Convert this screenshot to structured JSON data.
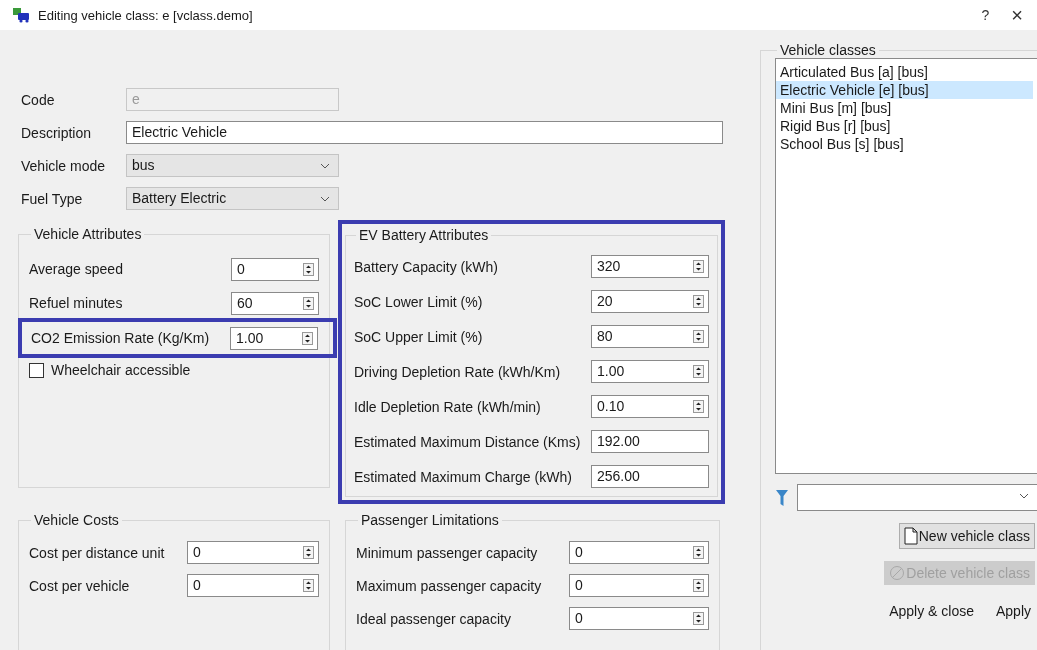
{
  "window": {
    "title": "Editing vehicle class: e [vclass.demo]",
    "help": "?",
    "close": "×"
  },
  "fields": [
    {
      "label": "Code",
      "kind": "text",
      "value": "e",
      "disabled": true
    },
    {
      "label": "Description",
      "kind": "text",
      "value": "Electric Vehicle",
      "disabled": false
    },
    {
      "label": "Vehicle mode",
      "kind": "dropdown",
      "value": "bus"
    },
    {
      "label": "Fuel Type",
      "kind": "dropdown",
      "value": "Battery Electric"
    }
  ],
  "vehicle_attributes": {
    "title": "Vehicle Attributes",
    "rows": [
      {
        "label": "Average speed",
        "value": "0",
        "highlighted": false
      },
      {
        "label": "Refuel minutes",
        "value": "60",
        "highlighted": false
      },
      {
        "label": "CO2 Emission Rate (Kg/Km)",
        "value": "1.00",
        "highlighted": true
      }
    ],
    "wheelchair": {
      "label": "Wheelchair accessible",
      "checked": false
    }
  },
  "ev_battery": {
    "title": "EV Battery Attributes",
    "highlighted": true,
    "rows": [
      {
        "label": "Battery Capacity (kWh)",
        "value": "320",
        "kind": "spin"
      },
      {
        "label": "SoC Lower Limit (%)",
        "value": "20",
        "kind": "spin"
      },
      {
        "label": "SoC Upper Limit (%)",
        "value": "80",
        "kind": "spin"
      },
      {
        "label": "Driving Depletion Rate (kWh/Km)",
        "value": "1.00",
        "kind": "spin"
      },
      {
        "label": "Idle Depletion Rate (kWh/min)",
        "value": "0.10",
        "kind": "spin"
      },
      {
        "label": "Estimated Maximum Distance (Kms)",
        "value": "192.00",
        "kind": "text"
      },
      {
        "label": "Estimated Maximum Charge (kWh)",
        "value": "256.00",
        "kind": "text"
      }
    ]
  },
  "vehicle_costs": {
    "title": "Vehicle Costs",
    "rows": [
      {
        "label": "Cost per distance unit",
        "value": "0"
      },
      {
        "label": "Cost per vehicle",
        "value": "0"
      }
    ]
  },
  "passenger_limitations": {
    "title": "Passenger Limitations",
    "rows": [
      {
        "label": "Minimum passenger capacity",
        "value": "0"
      },
      {
        "label": "Maximum passenger capacity",
        "value": "0"
      },
      {
        "label": "Ideal passenger capacity",
        "value": "0"
      }
    ]
  },
  "vehicle_classes": {
    "title": "Vehicle classes",
    "items": [
      {
        "label": "Articulated Bus [a] [bus]",
        "selected": false
      },
      {
        "label": "Electric Vehicle [e] [bus]",
        "selected": true
      },
      {
        "label": "Mini Bus [m] [bus]",
        "selected": false
      },
      {
        "label": "Rigid Bus [r] [bus]",
        "selected": false
      },
      {
        "label": "School Bus [s] [bus]",
        "selected": false
      }
    ]
  },
  "buttons": [
    {
      "label": "New vehicle class",
      "kind": "new",
      "disabled": false
    },
    {
      "label": "Delete vehicle class",
      "kind": "delete",
      "disabled": true
    },
    {
      "label": "Apply & close",
      "kind": "plain",
      "disabled": false
    },
    {
      "label": "Apply",
      "kind": "plain",
      "disabled": false
    }
  ]
}
